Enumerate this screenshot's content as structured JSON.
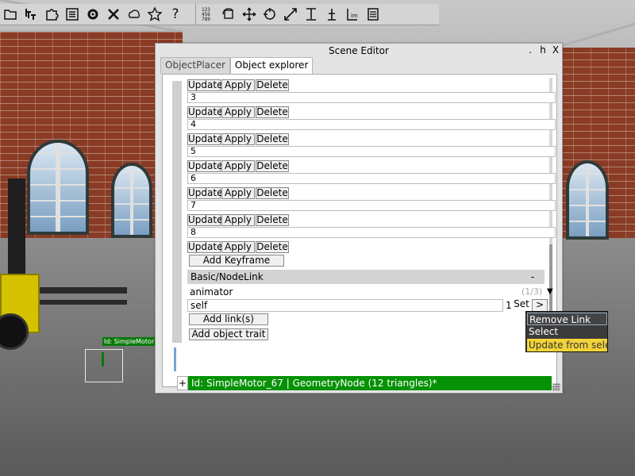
{
  "toolbar": {
    "group1": [
      "folder-icon",
      "tree-add-icon",
      "puzzle-icon",
      "list-icon",
      "gear-icon",
      "tools-icon",
      "weather-icon",
      "star-icon",
      "help-icon"
    ],
    "group2": [
      "number-grid-icon",
      "rotate-object-icon",
      "move-icon",
      "rotate-icon",
      "scale-icon",
      "align-icon",
      "anchor-icon",
      "text-im-icon",
      "document-icon"
    ],
    "help_glyph": "?"
  },
  "scene": {
    "motor_label": "Id: SimpleMotor"
  },
  "editor": {
    "title": "Scene Editor",
    "buttons": {
      "dot": ".",
      "help": "h",
      "close": "X"
    },
    "tabs": [
      {
        "label": "ObjectPlacer",
        "active": false
      },
      {
        "label": "Object explorer",
        "active": true
      }
    ],
    "keyframes": [
      {
        "index": "3"
      },
      {
        "index": "4"
      },
      {
        "index": "5"
      },
      {
        "index": "6"
      },
      {
        "index": "7"
      },
      {
        "index": "8"
      }
    ],
    "row_buttons": {
      "update": "Update",
      "apply": "Apply",
      "delete": "Delete"
    },
    "add_keyframe": "Add Keyframe",
    "section": {
      "title": "Basic/NodeLink",
      "collapse": "-"
    },
    "animator_label": "animator",
    "animator_count": "(1/3)",
    "self_value": "self",
    "set_count": "1",
    "set_label": "Set",
    "arrow_label": ">",
    "add_links": "Add link(s)",
    "add_trait": "Add object trait",
    "object_node": "Id: SimpleMotor_67 | GeometryNode (12 triangles)*",
    "plus": "+"
  },
  "context_menu": {
    "items": [
      {
        "label": "Remove Link",
        "state": "focused"
      },
      {
        "label": "Select",
        "state": "normal"
      },
      {
        "label": "Update from selec",
        "state": "highlighted"
      }
    ],
    "highlight_color": "#f2d43a",
    "bg_color": "#3b3b3b"
  }
}
